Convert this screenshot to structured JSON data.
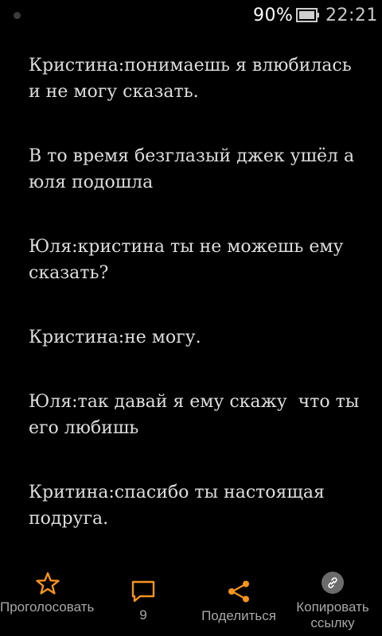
{
  "status_bar": {
    "battery_percent": "90%",
    "time": "22:21"
  },
  "story": {
    "paragraphs": [
      "Кристина:понимаешь я влюбилась и не могу сказать.",
      "В то время безглазый джек ушёл а юля подошла",
      "Юля:кристина ты не можешь ему сказать?",
      "Кристина:не могу.",
      "Юля:так давай я ему скажу  что ты его любишь",
      "Критина:спасибо ты настоящая подруга."
    ]
  },
  "bottom_bar": {
    "vote_label": "Проголосовать",
    "comments_count": "9",
    "share_label": "Поделиться",
    "copy_label": "Копировать ссылку"
  },
  "colors": {
    "accent": "#f7941d",
    "background": "#000000",
    "text": "#dedede"
  },
  "icons": [
    "star-icon",
    "comment-icon",
    "share-icon",
    "link-icon"
  ]
}
